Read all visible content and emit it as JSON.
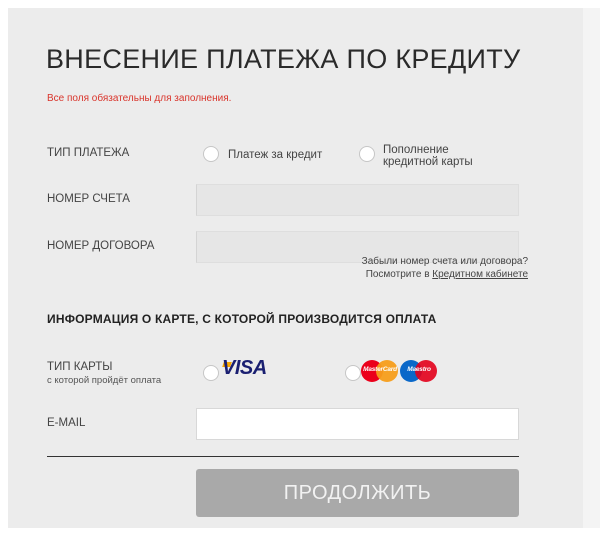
{
  "form": {
    "title": "ВНЕСЕНИЕ ПЛАТЕЖА ПО КРЕДИТУ",
    "required_note": "Все поля обязательны для заполнения.",
    "payment_type": {
      "label": "ТИП ПЛАТЕЖА",
      "options": [
        {
          "line1": "Платеж за кредит",
          "line2": ""
        },
        {
          "line1": "Пополнение",
          "line2": "кредитной карты"
        }
      ]
    },
    "account_number": {
      "label": "НОМЕР СЧЕТА",
      "value": ""
    },
    "contract_number": {
      "label": "НОМЕР ДОГОВОРА",
      "value": ""
    },
    "help": {
      "line1": "Забыли номер счета или договора?",
      "line2_prefix": "Посмотрите в ",
      "link": "Кредитном кабинете"
    },
    "card_section_title": "ИНФОРМАЦИЯ О КАРТЕ, С КОТОРОЙ ПРОИЗВОДИТСЯ ОПЛАТА",
    "card_type": {
      "label": "ТИП КАРТЫ",
      "sublabel": "с которой пройдёт оплата",
      "options": [
        {
          "brand": "VISA"
        },
        {
          "brand_a": "MasterCard",
          "brand_b": "Maestro"
        }
      ]
    },
    "email": {
      "label": "E-MAIL",
      "value": ""
    },
    "submit_label": "ПРОДОЛЖИТЬ"
  },
  "colors": {
    "required_note": "#d9342b",
    "visa_blue": "#1a1f71",
    "mc_red": "#eb001b",
    "mc_orange": "#f79e1b",
    "maestro_red": "#e3001b",
    "maestro_blue": "#0a68c9",
    "submit_bg": "#a9a9a9"
  }
}
